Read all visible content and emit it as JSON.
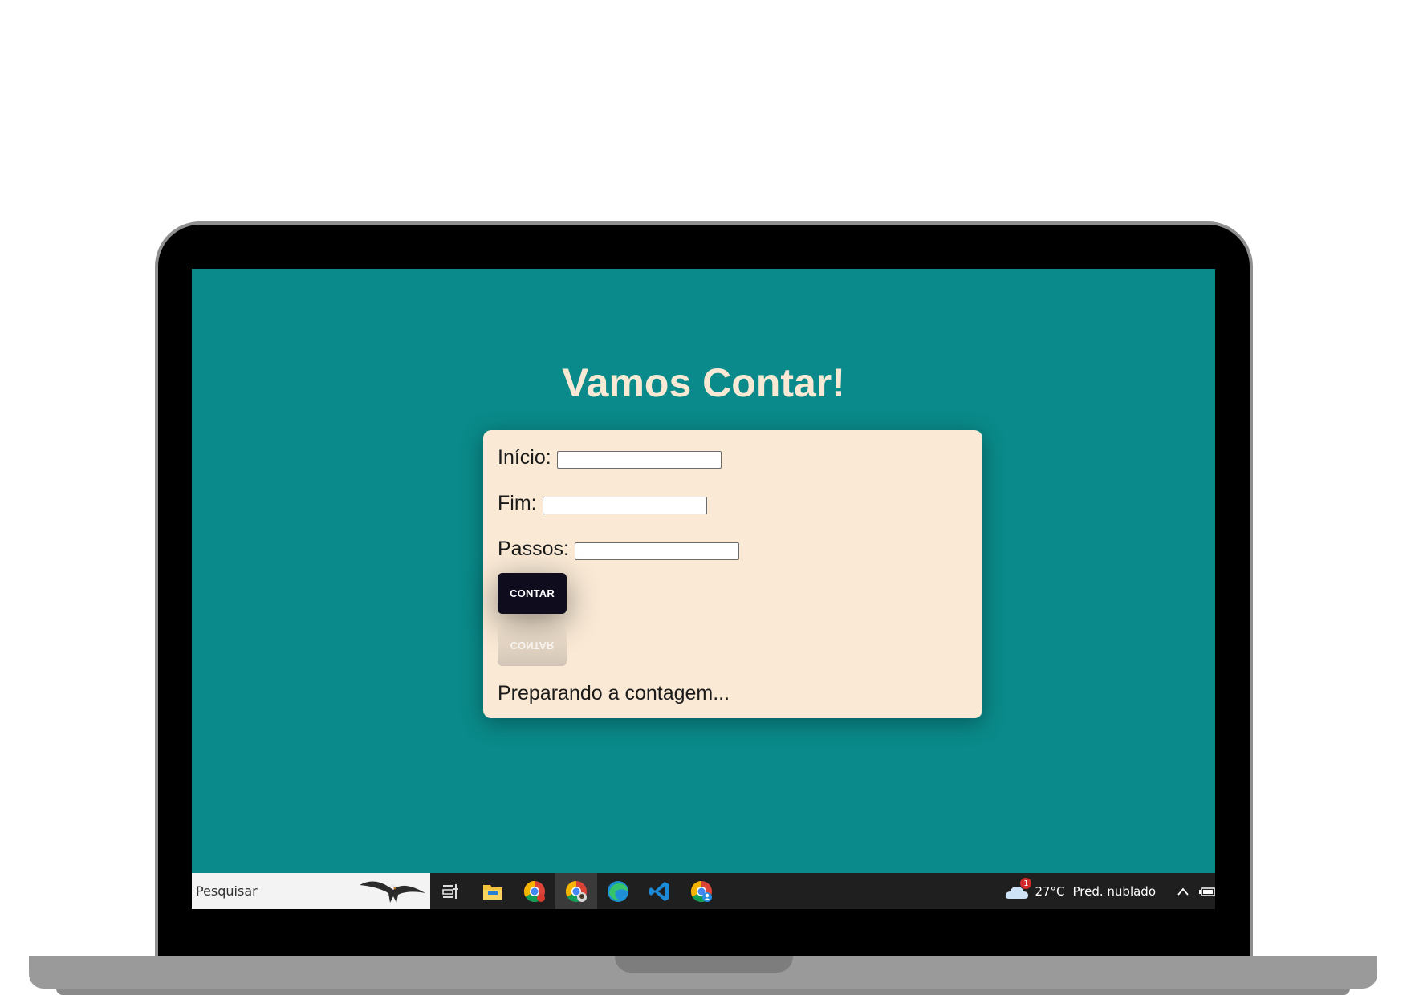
{
  "page": {
    "title": "Vamos Contar!"
  },
  "form": {
    "start_label": "Início:",
    "start_value": "",
    "end_label": "Fim:",
    "end_value": "",
    "step_label": "Passos:",
    "step_value": "",
    "button_label": "CONTAR",
    "status": "Preparando a contagem..."
  },
  "taskbar": {
    "search_placeholder": "Pesquisar",
    "apps": [
      "task-view-icon",
      "file-explorer-icon",
      "chrome-icon",
      "chrome-profile-icon",
      "edge-icon",
      "vscode-icon",
      "chrome-profile-2-icon"
    ],
    "weather_badge": "1",
    "temperature": "27°C",
    "weather": "Pred. nublado"
  },
  "colors": {
    "screen_bg": "#0a8a8a",
    "card_bg": "#f9e9d5",
    "title": "#f8e9d5",
    "button_bg": "#0f0c1d"
  }
}
